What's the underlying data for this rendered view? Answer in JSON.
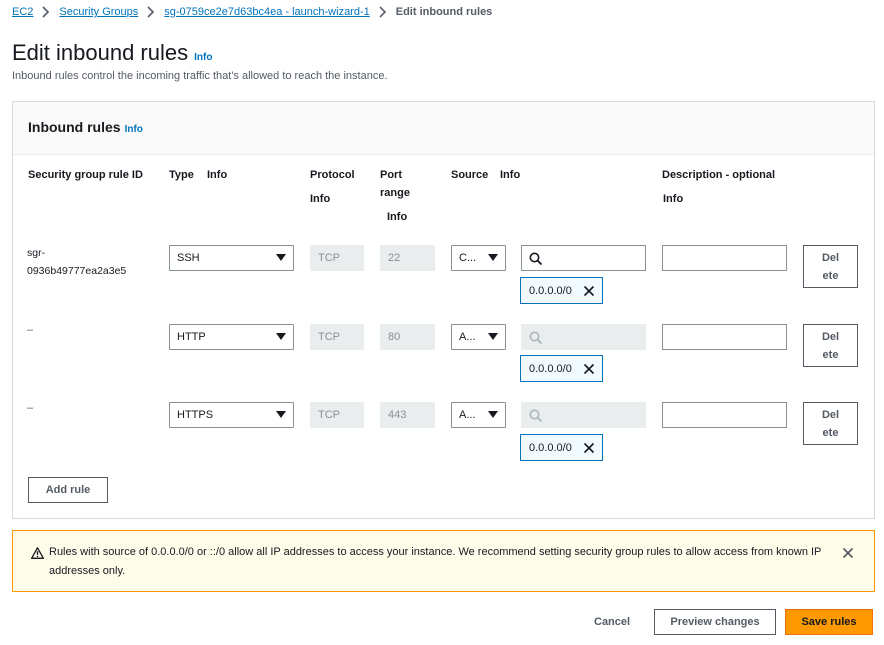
{
  "breadcrumb": {
    "items": [
      "EC2",
      "Security Groups",
      "sg-0759ce2e7d63bc4ea - launch-wizard-1"
    ],
    "current": "Edit inbound rules"
  },
  "page": {
    "title": "Edit inbound rules",
    "info": "Info",
    "description": "Inbound rules control the incoming traffic that's allowed to reach the instance."
  },
  "panel": {
    "title": "Inbound rules",
    "info": "Info",
    "columns": {
      "rule_id": "Security group rule ID",
      "type": "Type",
      "protocol": "Protocol",
      "port_line1": "Port",
      "port_line2": "range",
      "source": "Source",
      "description": "Description - optional",
      "info": "Info"
    },
    "rules": [
      {
        "id_line1": "sgr-",
        "id_line2": "0936b49777ea2a3e5",
        "type": "SSH",
        "protocol": "TCP",
        "port": "22",
        "source": "C...",
        "search": "",
        "token": "0.0.0.0/0",
        "description": "",
        "delete_line1": "Del",
        "delete_line2": "ete"
      },
      {
        "id": "–",
        "type": "HTTP",
        "protocol": "TCP",
        "port": "80",
        "source": "A...",
        "search": "",
        "token": "0.0.0.0/0",
        "description": "",
        "delete_line1": "Del",
        "delete_line2": "ete"
      },
      {
        "id": "–",
        "type": "HTTPS",
        "protocol": "TCP",
        "port": "443",
        "source": "A...",
        "search": "",
        "token": "0.0.0.0/0",
        "description": "",
        "delete_line1": "Del",
        "delete_line2": "ete"
      }
    ],
    "add_rule": "Add rule"
  },
  "alert": {
    "message": "Rules with source of 0.0.0.0/0 or ::/0 allow all IP addresses to access your instance. We recommend setting security group rules to allow access from known IP addresses only."
  },
  "footer": {
    "cancel": "Cancel",
    "preview": "Preview changes",
    "save": "Save rules"
  },
  "colors": {
    "link": "#0073bb",
    "primary": "#ff9900",
    "warning_bg": "#fffce9"
  }
}
